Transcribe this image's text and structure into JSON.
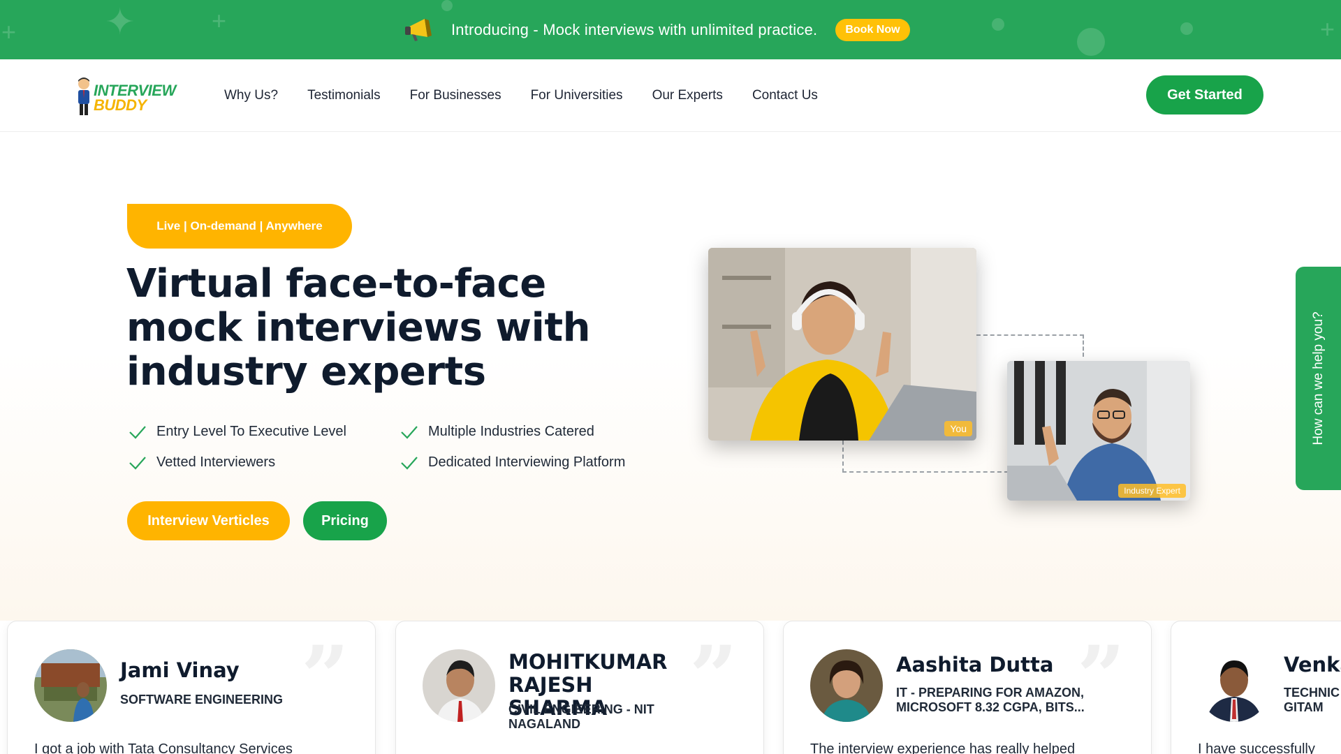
{
  "announcement": {
    "text": "Introducing - Mock interviews with unlimited practice.",
    "button": "Book Now",
    "icon": "megaphone-icon"
  },
  "header": {
    "logo_line1": "INTERVIEW",
    "logo_line2": "BUDDY",
    "nav": [
      "Why Us?",
      "Testimonials",
      "For Businesses",
      "For Universities",
      "Our Experts",
      "Contact Us"
    ],
    "cta": "Get Started"
  },
  "hero": {
    "tagline": "Live | On-demand | Anywhere",
    "headline_line1": "Virtual face-to-face",
    "headline_line2": "mock interviews with",
    "headline_line3": "industry experts",
    "features": [
      "Entry Level To Executive Level",
      "Multiple Industries Catered",
      "Vetted Interviewers",
      "Dedicated Interviewing Platform"
    ],
    "btn_primary": "Interview Verticles",
    "btn_secondary": "Pricing",
    "video_label_you": "You",
    "video_label_expert": "Industry Expert"
  },
  "side_tab": {
    "label": "How can we help you?"
  },
  "testimonials": [
    {
      "name": "Jami Vinay",
      "role": "SOFTWARE ENGINEERING",
      "text": "I got a job with Tata Consultancy Services"
    },
    {
      "name": "MOHITKUMAR RAJESH SHARMA",
      "role": "CIVIL ENGIEERING - NIT NAGALAND",
      "text": ""
    },
    {
      "name": "Aashita Dutta",
      "role": "IT - PREPARING FOR AMAZON, MICROSOFT 8.32 CGPA, BITS...",
      "text": "The interview experience has really helped"
    },
    {
      "name": "Venka",
      "role": "TECHNIC GITAM",
      "text": "I have successfully"
    }
  ],
  "colors": {
    "brand_green": "#27a65a",
    "button_green": "#18a34a",
    "brand_yellow": "#ffb400",
    "heading": "#0f1b2d"
  }
}
